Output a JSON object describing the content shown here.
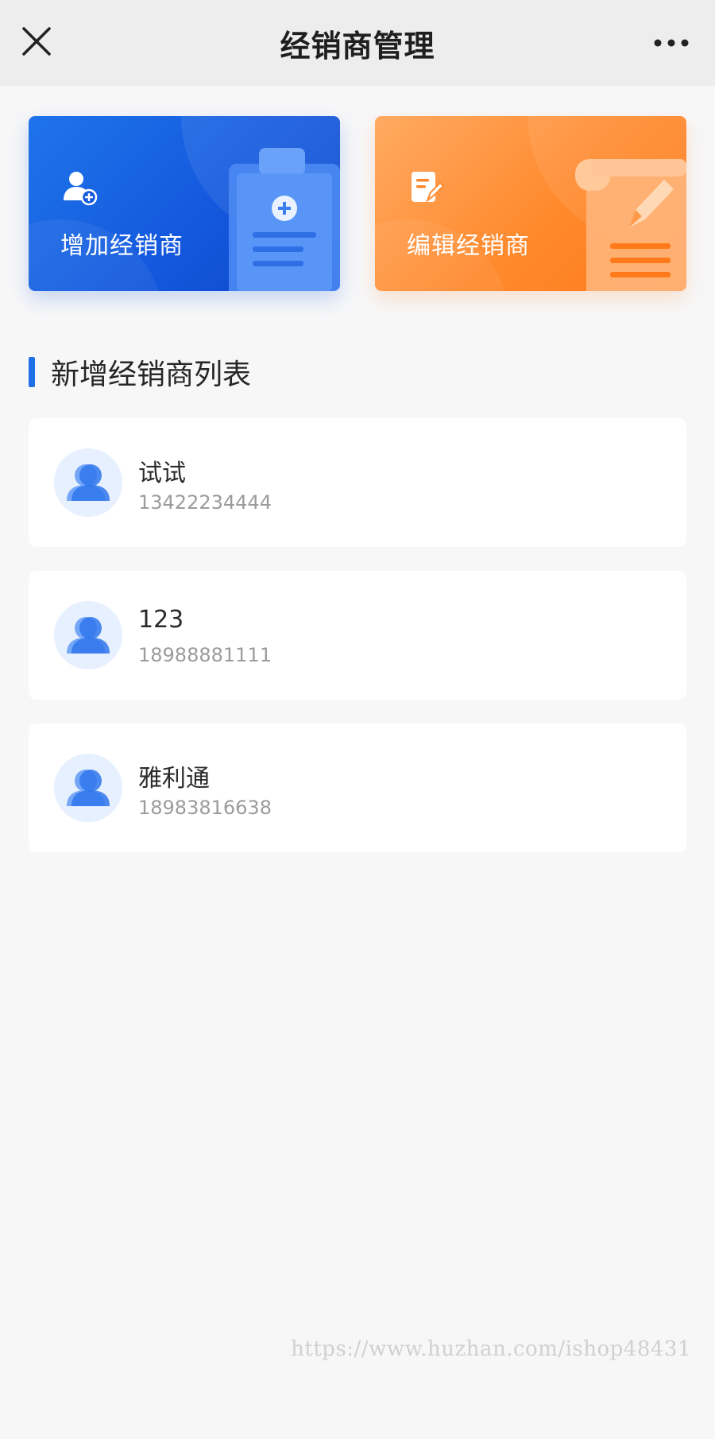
{
  "header": {
    "title": "经销商管理",
    "close_icon": "close-icon",
    "more_icon": "more-dots-icon"
  },
  "actions": [
    {
      "label": "增加经销商",
      "icon": "add-user-icon",
      "color": "#1459de"
    },
    {
      "label": "编辑经销商",
      "icon": "edit-document-icon",
      "color": "#ff8a2e"
    }
  ],
  "section": {
    "title": "新增经销商列表",
    "accent": "#1f6fe8"
  },
  "dealers": [
    {
      "name": "试试",
      "phone": "13422234444"
    },
    {
      "name": "123",
      "phone": "18988881111"
    },
    {
      "name": "雅利通",
      "phone": "18983816638"
    }
  ],
  "watermark": "https://www.huzhan.com/ishop48431"
}
